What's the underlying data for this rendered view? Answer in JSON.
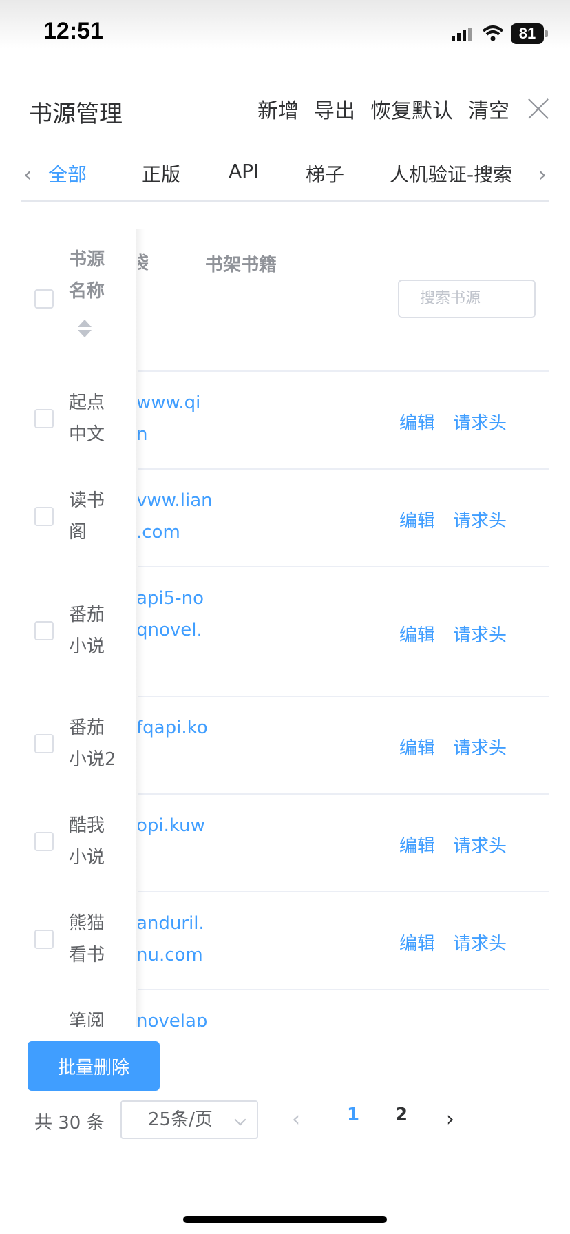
{
  "status": {
    "time": "12:51",
    "battery": "81"
  },
  "header": {
    "title": "书源管理",
    "actions": [
      "新增",
      "导出",
      "恢复默认",
      "清空"
    ]
  },
  "tabs": [
    "全部",
    "正版",
    "API",
    "梯子",
    "人机验证-搜索"
  ],
  "table": {
    "col_name_line1": "书源",
    "col_name_line2": "名称",
    "col_url_partial": "袋",
    "col_shelf": "书架书籍",
    "search_placeholder": "搜索书源",
    "rows": [
      {
        "name": "起点\n中文",
        "url": "www.qi\nn",
        "edit": "编辑",
        "headers": "请求头"
      },
      {
        "name": "读书\n阁",
        "url": "vww.lian\n.com",
        "edit": "编辑",
        "headers": "请求头"
      },
      {
        "name": "番茄\n小说",
        "url": "api5-no\nqnovel.",
        "edit": "编辑",
        "headers": "请求头"
      },
      {
        "name": "番茄\n小说2",
        "url": "fqapi.ko",
        "edit": "编辑",
        "headers": "请求头"
      },
      {
        "name": "酷我\n小说",
        "url": "opi.kuw",
        "edit": "编辑",
        "headers": "请求头"
      },
      {
        "name": "熊猫\n看书",
        "url": "anduril.\nnu.com",
        "edit": "编辑",
        "headers": "请求头"
      },
      {
        "name": "笔阅",
        "url": "novelap",
        "edit": "",
        "headers": ""
      }
    ]
  },
  "footer": {
    "batch_delete": "批量删除",
    "total": "共 30 条",
    "page_size": "25条/页",
    "pages": [
      "1",
      "2"
    ],
    "current_page": "1"
  },
  "colors": {
    "accent": "#409eff",
    "text": "#303133",
    "muted": "#909399"
  }
}
